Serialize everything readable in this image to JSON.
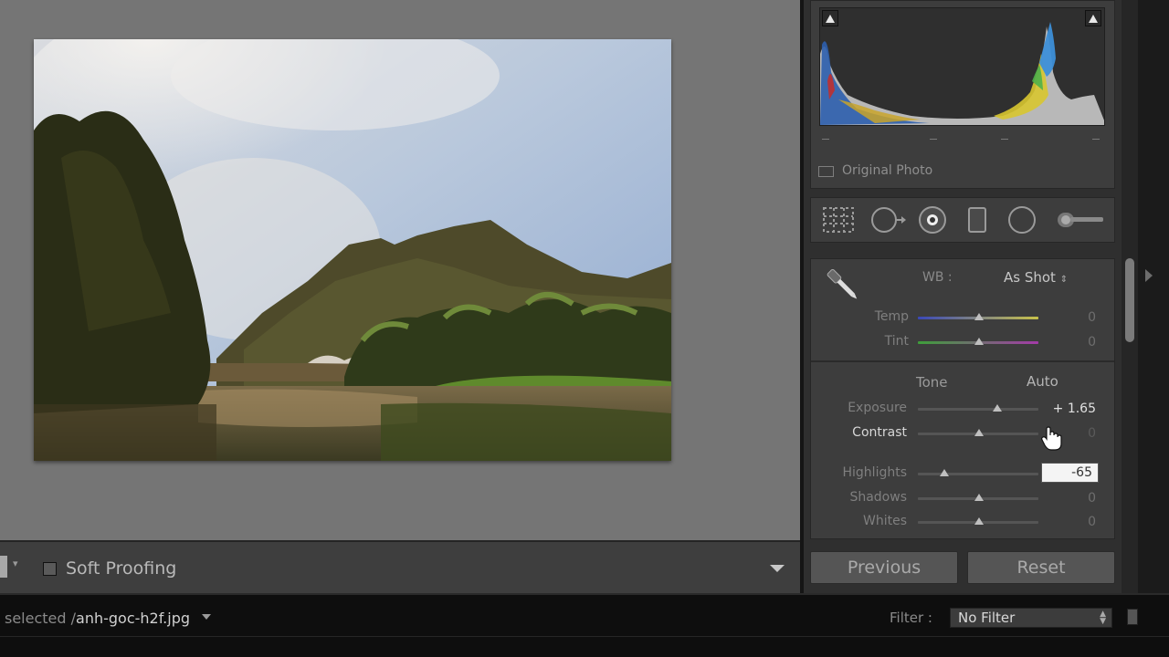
{
  "toolbar": {
    "soft_proofing_label": "Soft Proofing",
    "soft_proofing_checked": false
  },
  "histogram": {
    "original_photo_label": "Original Photo",
    "original_photo_checked": false
  },
  "tools": [
    "crop-overlay-icon",
    "spot-removal-icon",
    "red-eye-icon",
    "graduated-filter-icon",
    "radial-filter-icon",
    "adjustment-brush-icon"
  ],
  "basic": {
    "wb_label": "WB :",
    "wb_value": "As Shot",
    "tone_label": "Tone",
    "auto_label": "Auto",
    "sliders": [
      {
        "label": "Temp",
        "value": "0",
        "level": 0.5
      },
      {
        "label": "Tint",
        "value": "0",
        "level": 0.5
      },
      {
        "label": "Exposure",
        "value": "+ 1.65",
        "level": 0.665
      },
      {
        "label": "Contrast",
        "value": "0",
        "level": 0.5
      },
      {
        "label": "Highlights",
        "value": "-65",
        "level": 0.175
      },
      {
        "label": "Shadows",
        "value": "0",
        "level": 0.5
      },
      {
        "label": "Whites",
        "value": "0",
        "level": 0.5
      }
    ],
    "contrast_edit_value": "0"
  },
  "buttons": {
    "previous": "Previous",
    "reset": "Reset"
  },
  "filmstrip": {
    "status_prefix": "selected /",
    "filename": "anh-goc-h2f.jpg",
    "filter_label": "Filter :",
    "filter_value": "No Filter"
  }
}
